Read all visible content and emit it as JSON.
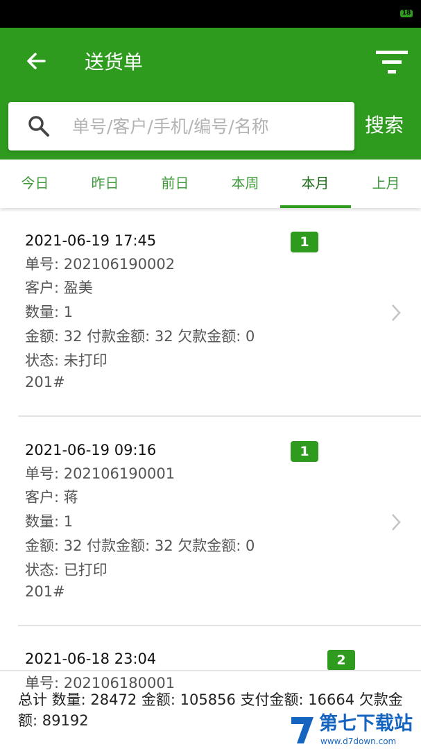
{
  "status_bar": {
    "battery": "18"
  },
  "header": {
    "title": "送货单"
  },
  "search": {
    "placeholder": "单号/客户/手机/编号/名称",
    "button_label": "搜索"
  },
  "tabs": [
    {
      "label": "今日"
    },
    {
      "label": "昨日"
    },
    {
      "label": "前日"
    },
    {
      "label": "本周"
    },
    {
      "label": "本月",
      "active": true
    },
    {
      "label": "上月"
    }
  ],
  "orders": [
    {
      "datetime": "2021-06-19 17:45",
      "badge": "1",
      "number": "单号: 202106190002",
      "customer": "客户: 盈美",
      "quantity": "数量: 1",
      "amounts": "金额: 32 付款金额: 32 欠款金额: 0",
      "status": "状态: 未打印",
      "note": "201#"
    },
    {
      "datetime": "2021-06-19 09:16",
      "badge": "1",
      "number": "单号: 202106190001",
      "customer": "客户: 蒋",
      "quantity": "数量: 1",
      "amounts": "金额: 32 付款金额: 32 欠款金额: 0",
      "status": "状态: 已打印",
      "note": "201#"
    },
    {
      "datetime": "2021-06-18 23:04",
      "badge": "2",
      "number": "单号: 202106180001"
    }
  ],
  "footer": {
    "summary": "总计 数量: 28472 金额: 105856 支付金额: 16664 欠款金额: 89192"
  },
  "watermark": {
    "name": "第七下载站",
    "url": "www.d7down.com"
  },
  "colors": {
    "primary": "#2e9a1e",
    "tab_text": "#3e9a3a",
    "divider": "#e3e3e3"
  }
}
